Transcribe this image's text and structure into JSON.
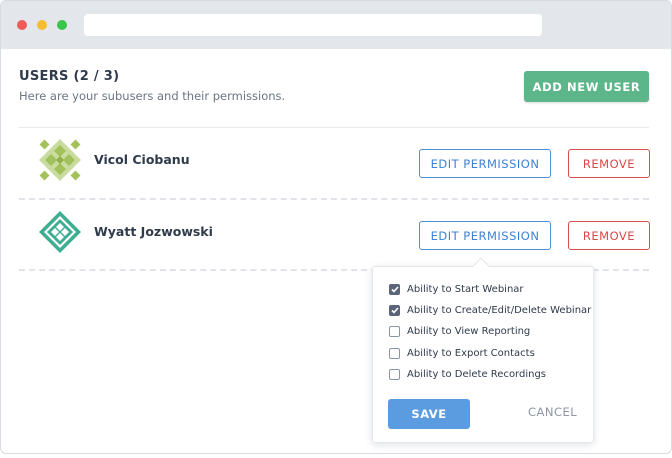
{
  "header": {
    "title": "USERS (2 / 3)",
    "subtitle": "Here are your subusers and their permissions.",
    "add_button": "ADD NEW USER"
  },
  "users": [
    {
      "name": "Vicol Ciobanu",
      "avatar_icon": "geometric-avatar-icon",
      "avatar_color": "#a3c15a",
      "edit_label": "EDIT PERMISSION",
      "remove_label": "REMOVE"
    },
    {
      "name": "Wyatt Jozwowski",
      "avatar_icon": "geometric-avatar-icon",
      "avatar_color": "#3fae92",
      "edit_label": "EDIT PERMISSION",
      "remove_label": "REMOVE"
    }
  ],
  "permissions_popover": {
    "items": [
      {
        "label": "Ability to Start Webinar",
        "checked": true
      },
      {
        "label": "Ability to Create/Edit/Delete Webinar",
        "checked": true
      },
      {
        "label": "Ability to View Reporting",
        "checked": false
      },
      {
        "label": "Ability to Export Contacts",
        "checked": false
      },
      {
        "label": "Ability to Delete Recordings",
        "checked": false
      }
    ],
    "save_label": "SAVE",
    "cancel_label": "CANCEL"
  },
  "colors": {
    "accent_green": "#5cb68a",
    "accent_blue": "#4e8fd9",
    "danger_red": "#d94d4d",
    "save_blue": "#5b9be0"
  }
}
